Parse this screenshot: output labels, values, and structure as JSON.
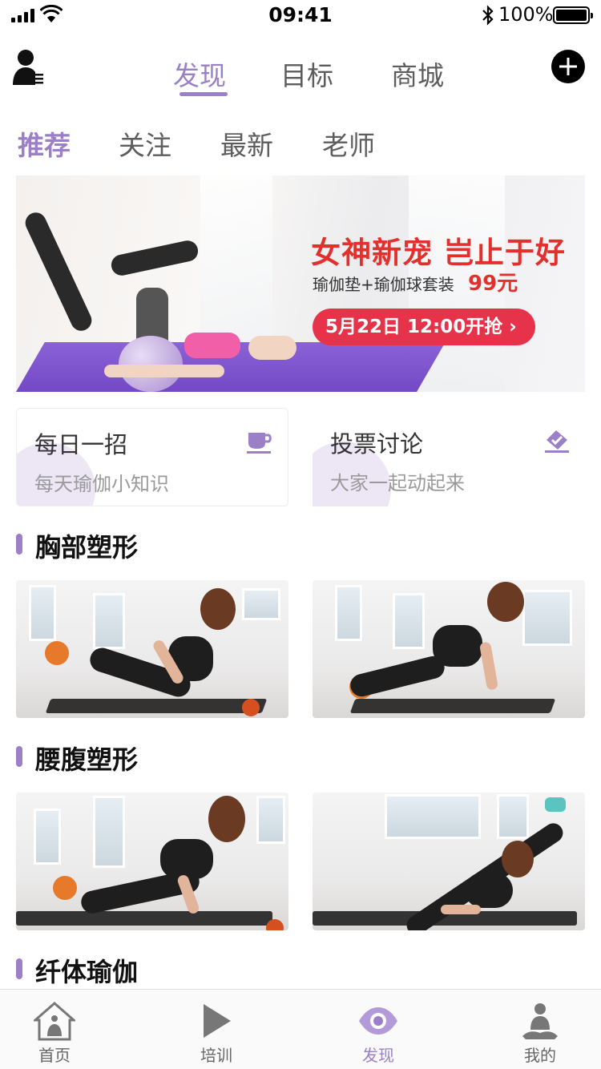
{
  "status_bar": {
    "time": "09:41",
    "battery": "100%"
  },
  "header": {
    "tabs": [
      {
        "label": "发现",
        "active": true
      },
      {
        "label": "目标",
        "active": false
      },
      {
        "label": "商城",
        "active": false
      }
    ],
    "user_icon": "user-menu-icon",
    "add_icon": "plus-icon"
  },
  "sub_tabs": [
    {
      "label": "推荐",
      "active": true
    },
    {
      "label": "关注",
      "active": false
    },
    {
      "label": "最新",
      "active": false
    },
    {
      "label": "老师",
      "active": false
    }
  ],
  "banner": {
    "title": "女神新宠  岂止于好",
    "subtitle": "瑜伽垫+瑜伽球套装",
    "price": "99元",
    "cta": "5月22日 12:00开抢 ›"
  },
  "cards": [
    {
      "title": "每日一招",
      "subtitle": "每天瑜伽小知识",
      "icon": "cup-icon"
    },
    {
      "title": "投票讨论",
      "subtitle": "大家一起动起来",
      "icon": "vote-icon"
    }
  ],
  "sections": [
    {
      "title": "胸部塑形"
    },
    {
      "title": "腰腹塑形"
    },
    {
      "title": "纤体瑜伽"
    }
  ],
  "tabbar": [
    {
      "label": "首页",
      "icon": "home-icon",
      "active": false
    },
    {
      "label": "培训",
      "icon": "play-icon",
      "active": false
    },
    {
      "label": "发现",
      "icon": "eye-icon",
      "active": true
    },
    {
      "label": "我的",
      "icon": "profile-icon",
      "active": false
    }
  ],
  "colors": {
    "accent": "#9b7fc7",
    "promo_red": "#e2302d",
    "text_gray": "#5d5d5d"
  }
}
